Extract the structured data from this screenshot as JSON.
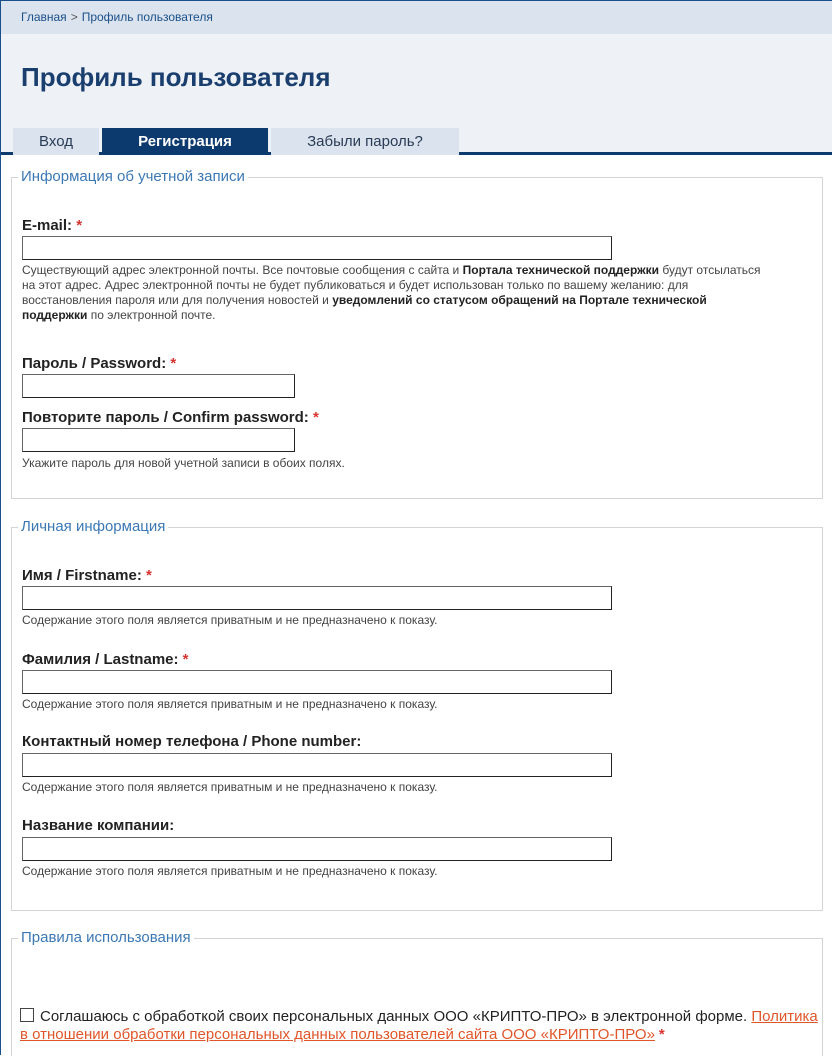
{
  "breadcrumb": {
    "home": "Главная",
    "separator": ">",
    "current": "Профиль пользователя"
  },
  "page_title": "Профиль пользователя",
  "tabs": [
    {
      "label": "Вход",
      "active": false
    },
    {
      "label": "Регистрация",
      "active": true
    },
    {
      "label": "Забыли пароль?",
      "active": false
    }
  ],
  "account": {
    "legend": "Информация об учетной записи",
    "email_label": "E-mail:",
    "email_value": "",
    "email_help_1": "Существующий адрес электронной почты. Все почтовые сообщения с сайта и ",
    "email_help_b1": "Портала технической поддержки",
    "email_help_2": " будут отсылаться на этот адрес. Адрес электронной почты не будет публиковаться и будет использован только по вашему желанию: для восстановления пароля или для получения новостей и ",
    "email_help_b2": "уведомлений со статусом обращений на Портале технической поддержки",
    "email_help_3": " по электронной почте.",
    "password_label": "Пароль / Password:",
    "password_value": "",
    "confirm_label": "Повторите пароль / Confirm password:",
    "confirm_value": "",
    "password_help": "Укажите пароль для новой учетной записи в обоих полях."
  },
  "personal": {
    "legend": "Личная информация",
    "firstname_label": "Имя / Firstname:",
    "lastname_label": "Фамилия / Lastname:",
    "phone_label": "Контактный номер телефона / Phone number:",
    "company_label": "Название компании:",
    "private_help": "Содержание этого поля является приватным и не предназначено к показу."
  },
  "rules": {
    "legend": "Правила использования",
    "agree_text": "Соглашаюсь с обработкой своих персональных данных ООО «КРИПТО-ПРО» в электронной форме. ",
    "policy_link": "Политика в отношении обработки персональных данных пользователей сайта ООО «КРИПТО-ПРО»",
    "agree_checked": false
  },
  "required_mark": "*",
  "colors": {
    "nav_dark": "#0d3a6e",
    "legend_blue": "#3c78b4",
    "required_red": "#d6332f",
    "link_orange": "#e0562a"
  }
}
